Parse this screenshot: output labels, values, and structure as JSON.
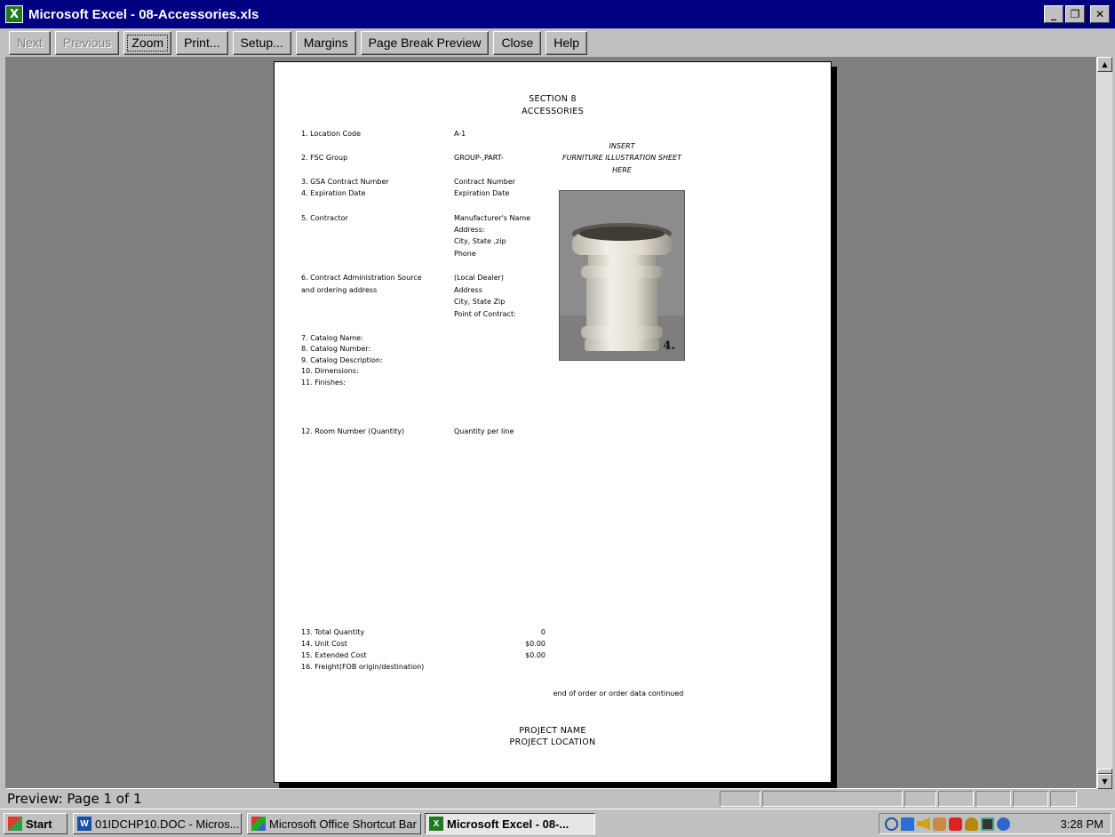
{
  "window": {
    "app_icon": "excel-icon",
    "title": "Microsoft Excel - 08-Accessories.xls",
    "controls": {
      "minimize": "_",
      "restore": "❐",
      "close": "✕"
    }
  },
  "toolbar": {
    "buttons": [
      {
        "label": "Next",
        "state": "disabled"
      },
      {
        "label": "Previous",
        "state": "disabled"
      },
      {
        "label": "Zoom",
        "state": "focused"
      },
      {
        "label": "Print...",
        "state": "enabled"
      },
      {
        "label": "Setup...",
        "state": "enabled"
      },
      {
        "label": "Margins",
        "state": "enabled"
      },
      {
        "label": "Page Break Preview",
        "state": "enabled"
      },
      {
        "label": "Close",
        "state": "enabled"
      },
      {
        "label": "Help",
        "state": "enabled"
      }
    ]
  },
  "page": {
    "section_title": "SECTION 8",
    "section_subtitle": "ACCESSORIES",
    "insert_note": [
      "INSERT",
      "FURNITURE ILLUSTRATION SHEET",
      "HERE"
    ],
    "photo": {
      "icon": "planter-photo",
      "badge": "4."
    },
    "fields": [
      {
        "label": "1.  Location Code",
        "value": "A-1"
      },
      {
        "label": "2.  FSC Group",
        "value": "GROUP-,PART-"
      },
      {
        "label": "3.  GSA Contract Number",
        "value": "Contract Number"
      },
      {
        "label": "4.  Expiration Date",
        "value": "Expiration Date"
      },
      {
        "label": "5. Contractor",
        "value": "Manufacturer's Name"
      },
      {
        "label": "6. Contract Administration Source",
        "value": "(Local Dealer)"
      },
      {
        "label": "and ordering address",
        "value": "Address"
      }
    ],
    "contractor_extra": [
      "Address:",
      "City, State ,zip",
      "Phone"
    ],
    "dealer_extra": [
      "City, State Zip",
      "Point of Contract:"
    ],
    "catalog_fields": [
      "7.  Catalog Name:",
      "8.  Catalog Number:",
      "9.  Catalog Description:",
      "10.  Dimensions:",
      "11. Finishes:"
    ],
    "room": {
      "label": "12.  Room Number (Quantity)",
      "value": "Quantity per line"
    },
    "totals": [
      {
        "label": "13.  Total Quantity",
        "value": "0"
      },
      {
        "label": "14.  Unit Cost",
        "value": "$0.00"
      },
      {
        "label": "15.  Extended Cost",
        "value": "$0.00"
      },
      {
        "label": "16.  Freight(FOB origin/destination)",
        "value": ""
      }
    ],
    "end_note": "end of order or order data continued",
    "footer": [
      "PROJECT NAME",
      "PROJECT LOCATION"
    ]
  },
  "status": {
    "text": "Preview: Page 1 of 1"
  },
  "taskbar": {
    "start": "Start",
    "tasks": [
      {
        "icon": "word-icon",
        "label": "01IDCHP10.DOC - Micros...",
        "active": false
      },
      {
        "icon": "office-shortcut-bar-icon",
        "label": "Microsoft Office Shortcut Bar",
        "active": false
      },
      {
        "icon": "excel-icon",
        "label": "Microsoft Excel - 08-...",
        "active": true
      }
    ],
    "clock": "3:28 PM"
  },
  "colors": {
    "titlebar": "#000080",
    "face": "#c0c0c0",
    "desktop_gray": "#808080",
    "excel_green": "#1f7a1f"
  }
}
